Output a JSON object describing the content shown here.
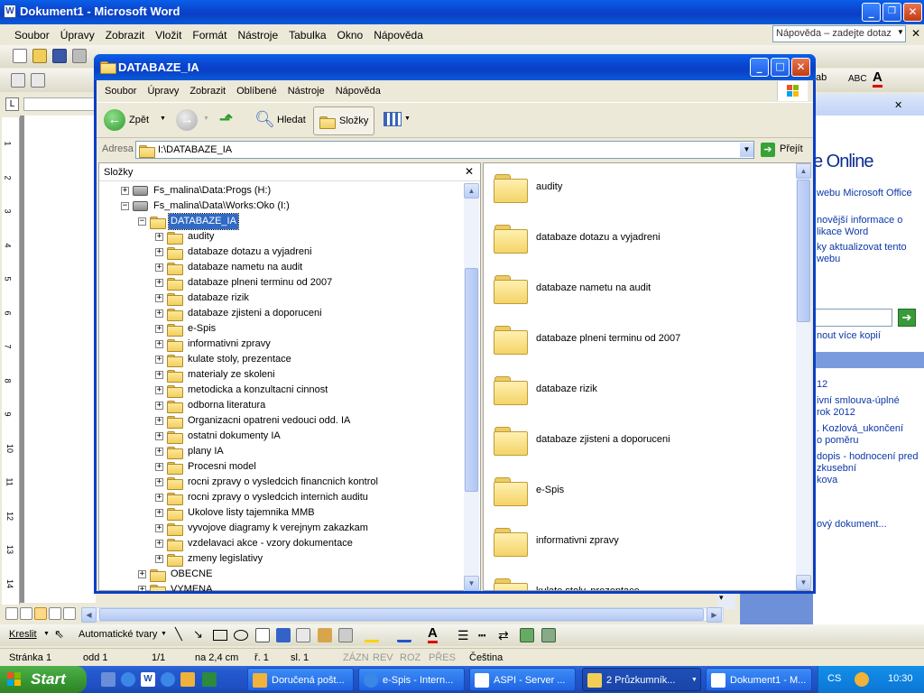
{
  "word": {
    "title": "Dokument1 - Microsoft Word",
    "menu": [
      "Soubor",
      "Úpravy",
      "Zobrazit",
      "Vložit",
      "Formát",
      "Nástroje",
      "Tabulka",
      "Okno",
      "Nápověda"
    ],
    "help_placeholder": "Nápověda – zadejte dotaz",
    "pane_heading": "e Online",
    "pane_links": [
      "webu Microsoft Office",
      "nověјší informace o",
      "likace Word",
      "ky aktualizovat tento",
      "webu",
      "nout více kopií",
      "12",
      "ivní smlouva-úplné",
      "rok 2012",
      ". Kozlová_ukončení",
      "o poměru",
      "dopis - hodnocení pred",
      "zkusební",
      "kova",
      "ový dokument..."
    ],
    "draw_label": "Kreslit",
    "autoshapes_label": "Automatické tvary",
    "status": {
      "page": "Stránka  1",
      "section": "odd  1",
      "pages": "1/1",
      "pos": "na  2,4 cm",
      "line": "ř.  1",
      "col": "sl.  1",
      "rec": "ZÁZN",
      "rev": "REV",
      "ext": "ROZ",
      "ovr": "PŘES",
      "lang": "Čeština"
    },
    "ruler_numbers": [
      "1",
      "2",
      "3",
      "4",
      "5",
      "6",
      "7",
      "8",
      "9",
      "10",
      "11",
      "12",
      "13",
      "14"
    ]
  },
  "explorer": {
    "title": "DATABAZE_IA",
    "menu": [
      "Soubor",
      "Úpravy",
      "Zobrazit",
      "Oblíbené",
      "Nástroje",
      "Nápověda"
    ],
    "back_label": "Zpět",
    "search_label": "Hledat",
    "folders_label": "Složky",
    "address_label": "Adresa",
    "address_value": "I:\\DATABAZE_IA",
    "go_label": "Přejít",
    "tree_header": "Složky",
    "tree": [
      {
        "label": "Fs_malina\\Data:Progs (H:)",
        "level": 0,
        "type": "drive",
        "expanded": false
      },
      {
        "label": "Fs_malina\\Data\\Works:Oko (I:)",
        "level": 0,
        "type": "drive",
        "expanded": true
      },
      {
        "label": "DATABAZE_IA",
        "level": 1,
        "type": "folder",
        "expanded": true,
        "selected": true
      },
      {
        "label": "audity",
        "level": 2,
        "type": "folder"
      },
      {
        "label": "databaze dotazu a vyjadreni",
        "level": 2,
        "type": "folder"
      },
      {
        "label": "databaze nametu na audit",
        "level": 2,
        "type": "folder"
      },
      {
        "label": "databaze plneni terminu od 2007",
        "level": 2,
        "type": "folder"
      },
      {
        "label": "databaze rizik",
        "level": 2,
        "type": "folder"
      },
      {
        "label": "databaze zjisteni a doporuceni",
        "level": 2,
        "type": "folder"
      },
      {
        "label": "e-Spis",
        "level": 2,
        "type": "folder"
      },
      {
        "label": "informativni zpravy",
        "level": 2,
        "type": "folder"
      },
      {
        "label": "kulate stoly, prezentace",
        "level": 2,
        "type": "folder"
      },
      {
        "label": "materialy ze skoleni",
        "level": 2,
        "type": "folder"
      },
      {
        "label": "metodicka a konzultacni cinnost",
        "level": 2,
        "type": "folder"
      },
      {
        "label": "odborna literatura",
        "level": 2,
        "type": "folder"
      },
      {
        "label": "Organizacni opatreni vedouci odd. IA",
        "level": 2,
        "type": "folder"
      },
      {
        "label": "ostatni dokumenty IA",
        "level": 2,
        "type": "folder"
      },
      {
        "label": "plany IA",
        "level": 2,
        "type": "folder"
      },
      {
        "label": "Procesni model",
        "level": 2,
        "type": "folder"
      },
      {
        "label": "rocni zpravy o vysledcich financnich kontrol",
        "level": 2,
        "type": "folder"
      },
      {
        "label": "rocni zpravy o vysledcich internich auditu",
        "level": 2,
        "type": "folder"
      },
      {
        "label": "Ukolove listy tajemnika MMB",
        "level": 2,
        "type": "folder"
      },
      {
        "label": "vyvojove diagramy k verejnym zakazkam",
        "level": 2,
        "type": "folder"
      },
      {
        "label": "vzdelavaci akce - vzory dokumentace",
        "level": 2,
        "type": "folder"
      },
      {
        "label": "zmeny legislativy",
        "level": 2,
        "type": "folder"
      },
      {
        "label": "OBECNE",
        "level": 1,
        "type": "folder"
      },
      {
        "label": "VYMENA",
        "level": 1,
        "type": "folder"
      }
    ],
    "files": [
      "audity",
      "databaze dotazu a vyjadreni",
      "databaze nametu na audit",
      "databaze plneni terminu od 2007",
      "databaze rizik",
      "databaze zjisteni a doporuceni",
      "e-Spis",
      "informativni zpravy",
      "kulate stoly, prezentace"
    ]
  },
  "taskbar": {
    "start_label": "Start",
    "tasks": [
      "Doručená pošt...",
      "e-Spis - Intern...",
      "ASPI - Server ...",
      "2 Průzkumník...",
      "Dokument1 - M..."
    ],
    "lang": "CS",
    "time": "10:30"
  }
}
